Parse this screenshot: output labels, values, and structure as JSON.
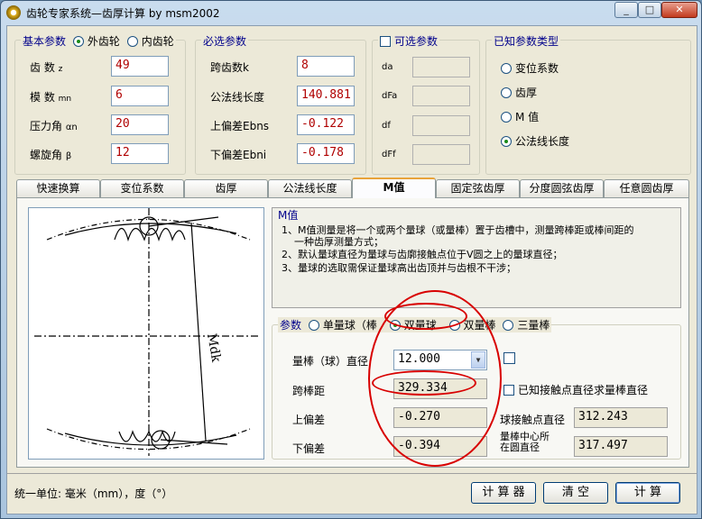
{
  "window": {
    "title": "齿轮专家系统—齿厚计算 by msm2002"
  },
  "basic": {
    "label": "基本参数",
    "external": "外齿轮",
    "internal": "内齿轮",
    "fields": [
      {
        "label": "齿 数",
        "sym": "z",
        "value": "49"
      },
      {
        "label": "模 数",
        "sym": "mn",
        "value": "6"
      },
      {
        "label": "压力角",
        "sym": "αn",
        "value": "20"
      },
      {
        "label": "螺旋角",
        "sym": "β",
        "value": "12"
      }
    ]
  },
  "required": {
    "label": "必选参数",
    "fields": [
      {
        "label": "跨齿数k",
        "value": "8"
      },
      {
        "label": "公法线长度",
        "value": "140.881"
      },
      {
        "label": "上偏差Ebns",
        "value": "-0.122"
      },
      {
        "label": "下偏差Ebni",
        "value": "-0.178"
      }
    ]
  },
  "optional": {
    "label": "可选参数",
    "fields": [
      "da",
      "dFa",
      "df",
      "dFf"
    ]
  },
  "known": {
    "label": "已知参数类型",
    "options": [
      "变位系数",
      "齿厚",
      "M 值",
      "公法线长度"
    ],
    "selected": "公法线长度"
  },
  "tabs": [
    "快速换算",
    "变位系数",
    "齿厚",
    "公法线长度",
    "M值",
    "固定弦齿厚",
    "分度圆弦齿厚",
    "任意圆齿厚"
  ],
  "active_tab": "M值",
  "figure": {
    "dim_label": "Mdk"
  },
  "mvalue": {
    "label": "M值",
    "lines": [
      "1、M值测量是将一个或两个量球（或量棒）置于齿槽中，测量跨棒距或棒间距的",
      "一种齿厚测量方式；",
      "2、默认量球直径为量球与齿廓接触点位于V圆之上的量球直径；",
      "3、量球的选取需保证量球高出齿顶并与齿根不干涉；"
    ]
  },
  "params": {
    "label": "参数",
    "modes": [
      "单量球（棒",
      "双量球",
      "双量棒",
      "三量棒"
    ],
    "selected": "双量球",
    "dia_label": "量棒（球）直径",
    "dia_value": "12.000",
    "span_label": "跨棒距",
    "span_value": "329.334",
    "upper_label": "上偏差",
    "upper_value": "-0.270",
    "lower_label": "下偏差",
    "lower_value": "-0.394",
    "known_contact_label": "已知接触点直径求量棒直径",
    "contact_label": "球接触点直径",
    "contact_value": "312.243",
    "center_label_1": "量棒中心所",
    "center_label_2": "在圆直径",
    "center_value": "317.497"
  },
  "footer": {
    "unit": "统一单位:  毫米（mm），度（°）",
    "calc": "计 算 器",
    "clear": "清   空",
    "compute": "计   算"
  }
}
